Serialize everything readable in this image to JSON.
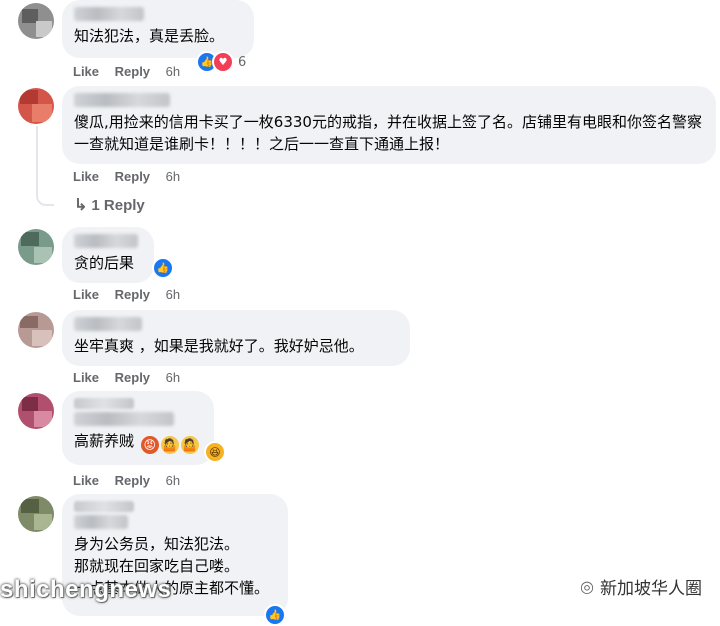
{
  "actions": {
    "like": "Like",
    "reply": "Reply"
  },
  "comments": [
    {
      "text": "知法犯法，真是丢脸。",
      "time": "6h",
      "reaction_count": "6"
    },
    {
      "text": "傻瓜,用捡来的信用卡买了一枚6330元的戒指，并在收据上签了名。店铺里有电眼和你签名警察一查就知道是谁刷卡！！！！之后一一查直下通通上报！",
      "time": "6h",
      "replies_label": "1 Reply"
    },
    {
      "text": "贪的后果",
      "time": "6h"
    },
    {
      "text": "坐牢真爽 ，如果是我就好了。我好妒忌他。",
      "time": "6h"
    },
    {
      "text": "高薪养贼",
      "time": "6h",
      "emojis": [
        "angry-face",
        "shrug-person",
        "shrug-person",
        "laughing-face"
      ]
    },
    {
      "text": "身为公务员，知法犯法。\n那就现在回家吃自己喽。\n一点基本做人的原主都不懂。"
    }
  ],
  "watermark": {
    "left": "shichengnews",
    "right": "新加坡华人圈"
  },
  "colors": {
    "bubble": "#f0f2f5",
    "like": "#1877f2",
    "love": "#f33e58",
    "meta": "#65676b"
  }
}
